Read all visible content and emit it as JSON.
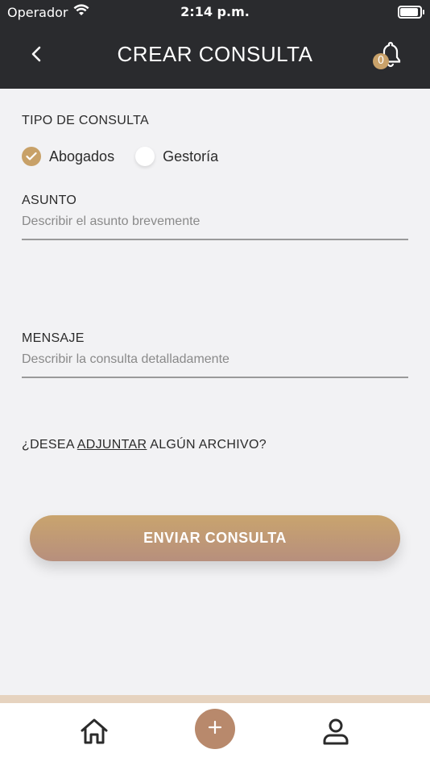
{
  "status": {
    "carrier": "Operador",
    "time": "2:14 p.m."
  },
  "header": {
    "title": "CREAR CONSULTA",
    "notification_count": "0"
  },
  "form": {
    "tipo_label": "TIPO DE CONSULTA",
    "options": [
      {
        "label": "Abogados",
        "selected": true
      },
      {
        "label": "Gestoría",
        "selected": false
      }
    ],
    "asunto_label": "ASUNTO",
    "asunto_placeholder": "Describir el asunto brevemente",
    "mensaje_label": "MENSAJE",
    "mensaje_placeholder": "Describir la consulta detalladamente",
    "attach_prefix": "¿DESEA ",
    "attach_link": "ADJUNTAR",
    "attach_suffix": " ALGÚN ARCHIVO?",
    "submit_label": "ENVIAR CONSULTA"
  },
  "colors": {
    "accent": "#c8a168",
    "header_bg": "#2a2b2e",
    "tab_add": "#b8896c"
  },
  "icons": {
    "back": "chevron-left-icon",
    "bell": "bell-icon",
    "home": "home-icon",
    "add": "plus-icon",
    "profile": "user-icon",
    "wifi": "wifi-icon",
    "battery": "battery-icon"
  }
}
